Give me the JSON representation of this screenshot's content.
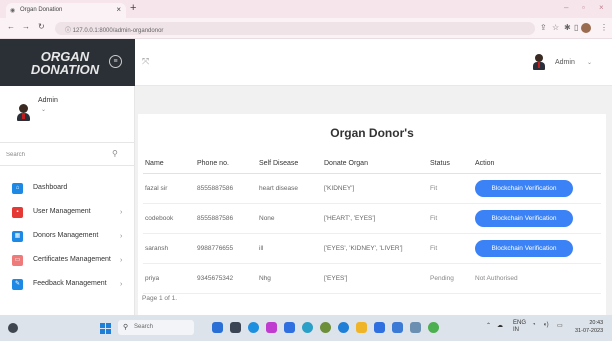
{
  "browser": {
    "tab_title": "Organ Donation",
    "url": "127.0.0.1:8000/admin-organdonor"
  },
  "sidebar": {
    "brand_line1": "ORGAN",
    "brand_line2": "DONATION",
    "user_name": "Admin",
    "search_placeholder": "Search",
    "items": [
      {
        "label": "Dashboard",
        "icon": "dashboard-icon",
        "color": "#1e88e5"
      },
      {
        "label": "User Management",
        "icon": "users-icon",
        "color": "#e53935"
      },
      {
        "label": "Donors Management",
        "icon": "donors-icon",
        "color": "#1e88e5"
      },
      {
        "label": "Certificates Management",
        "icon": "certificate-icon",
        "color": "#ef7a7a"
      },
      {
        "label": "Feedback Management",
        "icon": "feedback-icon",
        "color": "#1e88e5"
      }
    ]
  },
  "header": {
    "user_label": "Admin"
  },
  "main": {
    "title": "Organ Donor's",
    "columns": [
      "Name",
      "Phone no.",
      "Self Disease",
      "Donate Organ",
      "Status",
      "Action"
    ],
    "rows": [
      {
        "name": "fazal sir",
        "phone": "8555887586",
        "disease": "heart disease",
        "organ": "['KIDNEY']",
        "status": "Fit",
        "action": "Blockchain Verification",
        "action_type": "button"
      },
      {
        "name": "codebook",
        "phone": "8555887586",
        "disease": "None",
        "organ": "['HEART', 'EYES']",
        "status": "Fit",
        "action": "Blockchain Verification",
        "action_type": "button"
      },
      {
        "name": "saransh",
        "phone": "9988776655",
        "disease": "ill",
        "organ": "['EYES', 'KIDNEY', 'LIVER']",
        "status": "Fit",
        "action": "Blockchain Verification",
        "action_type": "button"
      },
      {
        "name": "priya",
        "phone": "9345675342",
        "disease": "Nhg",
        "organ": "['EYES']",
        "status": "Pending",
        "action": "Not Authorised",
        "action_type": "text"
      }
    ],
    "pagination": "Page 1 of 1."
  },
  "taskbar": {
    "search_placeholder": "Search",
    "lang_line1": "ENG",
    "lang_line2": "IN",
    "time": "20:43",
    "date": "31-07-2023"
  },
  "colors": {
    "accent": "#3b82f6",
    "brand_bg": "#2b3036",
    "browser_tabbar": "#f6e5eb"
  }
}
